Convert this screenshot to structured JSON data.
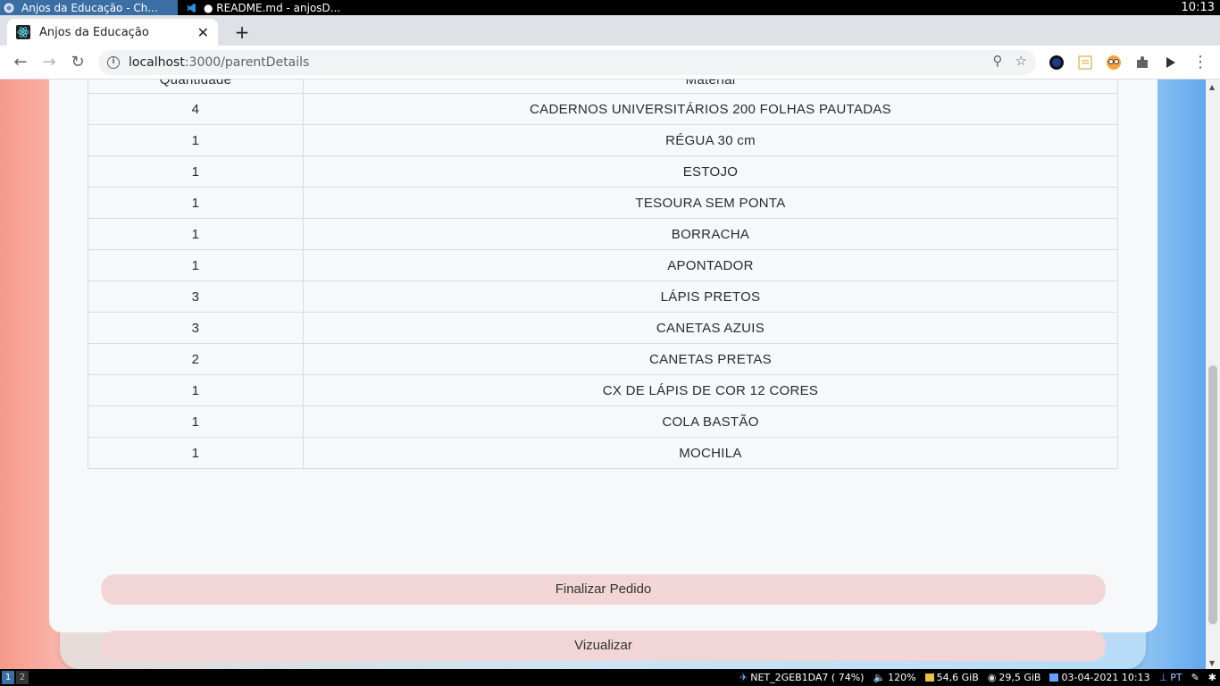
{
  "os": {
    "tasks": [
      {
        "label": "Anjos da Educação - Ch..."
      },
      {
        "label": "● README.md - anjosD..."
      }
    ],
    "clock": "10:13",
    "workspaces": [
      "1",
      "2"
    ],
    "tray": {
      "network": "NET_2GEB1DA7 ( 74%)",
      "volume": "120%",
      "disk1": "54,6 GiB",
      "disk2": "29,5 GiB",
      "datetime": "03-04-2021 10:13",
      "lang": "PT"
    }
  },
  "browser": {
    "tab_title": "Anjos da Educação",
    "url_host": "localhost",
    "url_path": ":3000/parentDetails"
  },
  "table": {
    "headers": {
      "qty": "Quantidade",
      "material": "Material"
    },
    "rows": [
      {
        "qty": "4",
        "material": "CADERNOS UNIVERSITÁRIOS 200 FOLHAS PAUTADAS"
      },
      {
        "qty": "1",
        "material": "RÉGUA 30 cm"
      },
      {
        "qty": "1",
        "material": "ESTOJO"
      },
      {
        "qty": "1",
        "material": "TESOURA SEM PONTA"
      },
      {
        "qty": "1",
        "material": "BORRACHA"
      },
      {
        "qty": "1",
        "material": "APONTADOR"
      },
      {
        "qty": "3",
        "material": "LÁPIS PRETOS"
      },
      {
        "qty": "3",
        "material": "CANETAS AZUIS"
      },
      {
        "qty": "2",
        "material": "CANETAS PRETAS"
      },
      {
        "qty": "1",
        "material": "CX DE LÁPIS DE COR 12 CORES"
      },
      {
        "qty": "1",
        "material": "COLA BASTÃO"
      },
      {
        "qty": "1",
        "material": "MOCHILA"
      }
    ]
  },
  "actions": {
    "finalizar": "Finalizar Pedido",
    "visualizar": "Vizualizar"
  },
  "colors": {
    "button_bg": "#f1d5d7",
    "card_bg": "#f7f8fa"
  }
}
